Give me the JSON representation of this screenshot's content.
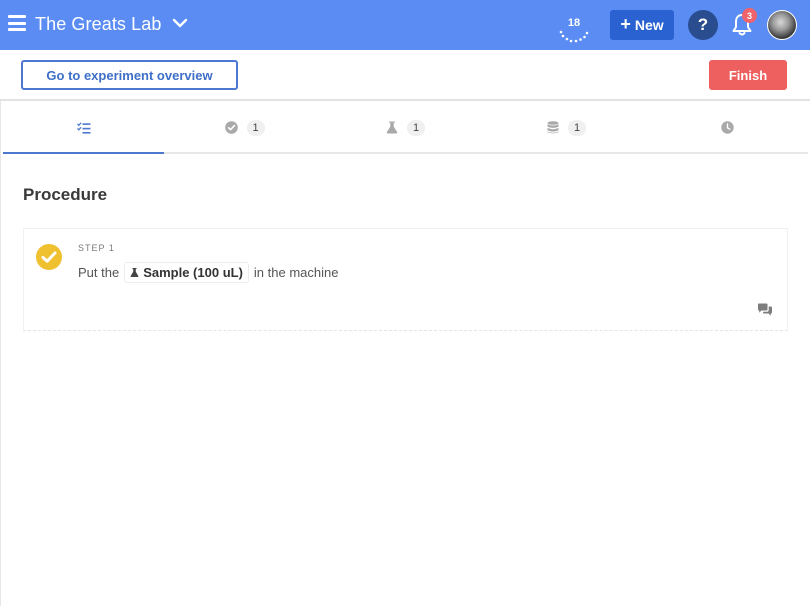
{
  "topbar": {
    "lab_name": "The Greats Lab",
    "counter": "18",
    "new_label": "New",
    "help_label": "?",
    "notification_count": "3"
  },
  "actions": {
    "overview_label": "Go to experiment overview",
    "finish_label": "Finish"
  },
  "tabs": [
    {
      "icon": "checklist-icon",
      "count": null
    },
    {
      "icon": "check-circle-icon",
      "count": "1"
    },
    {
      "icon": "flask-icon",
      "count": "1"
    },
    {
      "icon": "database-icon",
      "count": "1"
    },
    {
      "icon": "clock-icon",
      "count": null
    }
  ],
  "procedure": {
    "title": "Procedure",
    "steps": [
      {
        "label": "STEP 1",
        "text_before": "Put the",
        "sample": "Sample (100 uL)",
        "text_after": "in the machine",
        "status": "completed"
      }
    ]
  },
  "colors": {
    "topbar": "#5a8cf3",
    "new_button": "#2a62d2",
    "help_button": "#2a4d8f",
    "finish_button": "#ee5f5f",
    "accent": "#4d78cf",
    "step_check": "#efc02f",
    "badge": "#f0636a"
  }
}
